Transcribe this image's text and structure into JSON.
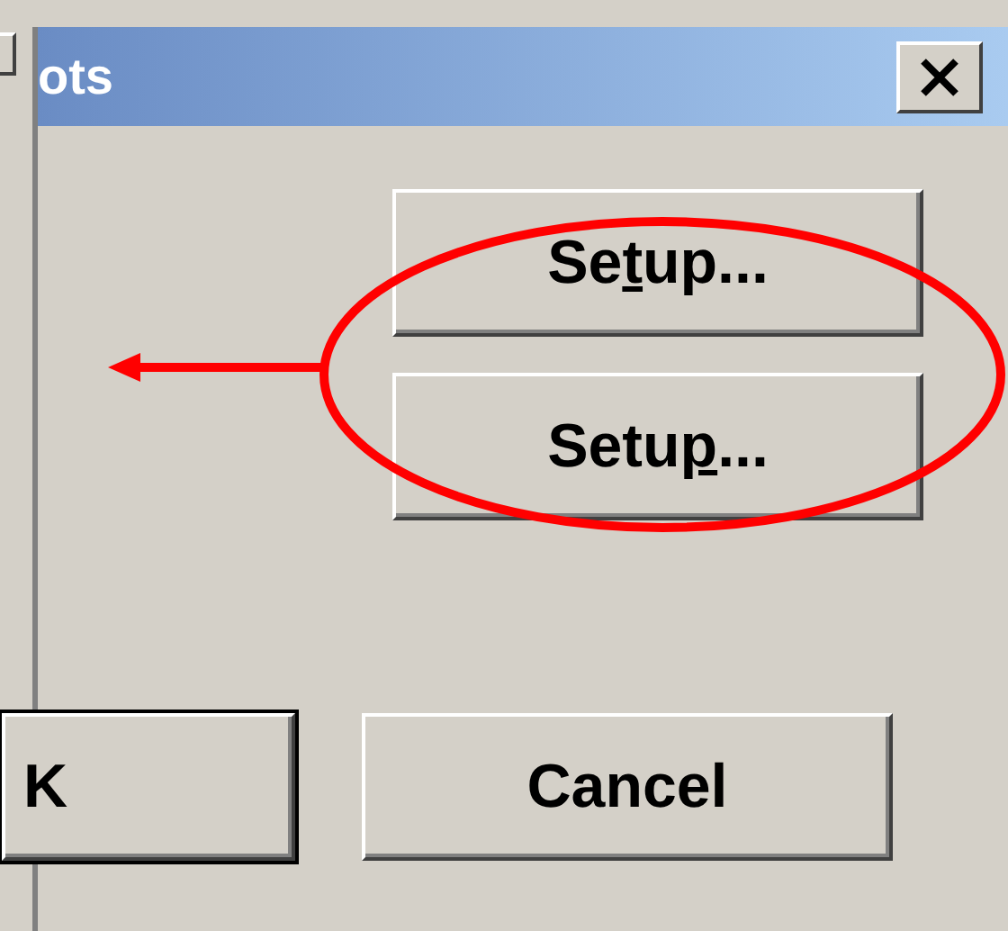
{
  "window": {
    "title": "ots"
  },
  "setup_buttons": [
    {
      "before": "Se",
      "key": "t",
      "after": "up..."
    },
    {
      "before": "Setu",
      "key": "p",
      "after": "..."
    }
  ],
  "buttons": [
    {
      "label": "K",
      "default": true
    },
    {
      "label": "Cancel",
      "default": false
    }
  ]
}
